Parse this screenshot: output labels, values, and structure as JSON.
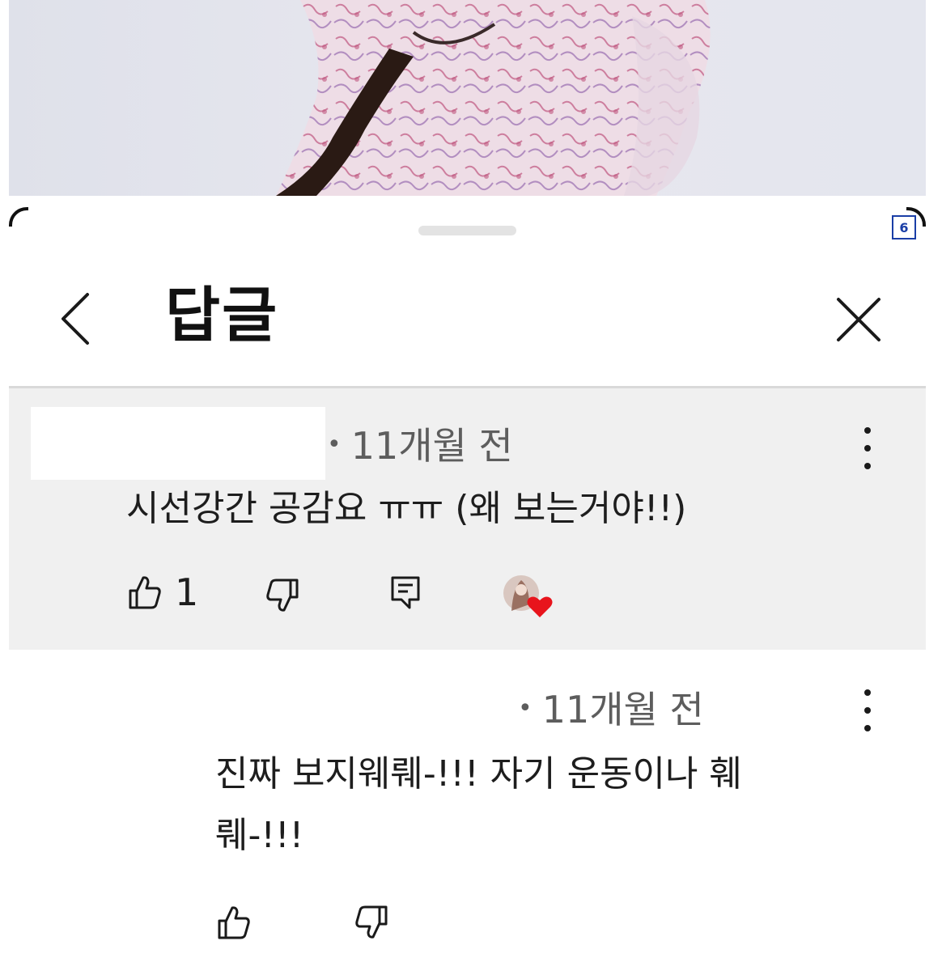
{
  "page_badge": "6",
  "header": {
    "title": "답글"
  },
  "comments": [
    {
      "time": "11개월 전",
      "text": "시선강간 공감요 ㅠㅠ (왜 보는거야!!)",
      "like_count": "1",
      "creator_heart": true
    },
    {
      "time": "11개월 전",
      "text_line1": "진짜 보지웨뤠-!!! 자기 운동이나 훼",
      "text_line2": "뤠-!!!",
      "like_count": ""
    }
  ],
  "colors": {
    "highlight_bg": "#f0f0f0",
    "heart": "#e8141c",
    "badge": "#1a3ea6"
  },
  "icons": [
    "chevron-left-icon",
    "close-icon",
    "thumb-up-icon",
    "thumb-down-icon",
    "reply-icon",
    "more-vert-icon",
    "heart-icon"
  ]
}
